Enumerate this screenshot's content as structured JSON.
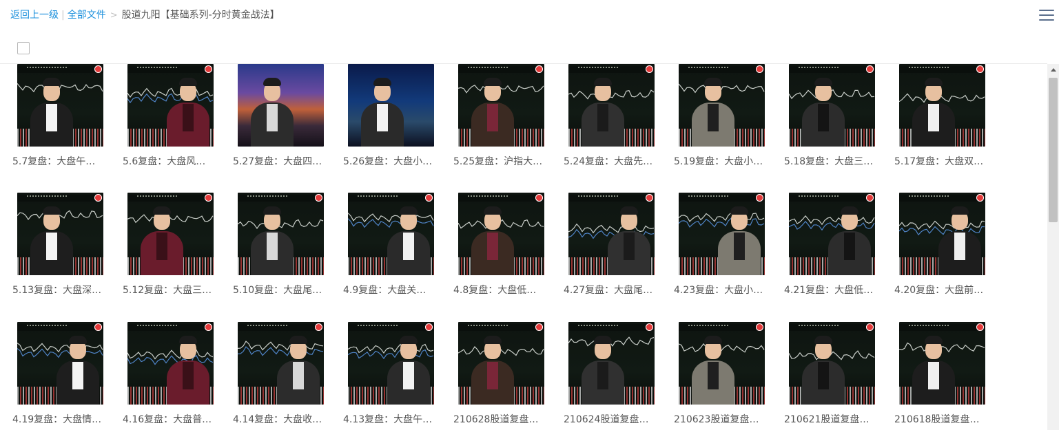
{
  "breadcrumb": {
    "back": "返回上一级",
    "separator": "|",
    "all_files": "全部文件",
    "arrow": ">",
    "current": "股道九阳【基础系列-分时黄金战法】"
  },
  "icons": {
    "menu": "hamburger-menu-icon",
    "select_all": "checkbox"
  },
  "colors": {
    "link": "#1a8fdc",
    "menu_icon": "#5a6e8c",
    "badge": "#e43a3a"
  },
  "files": [
    {
      "title": "5.7复盘：大盘午…",
      "style": "chart"
    },
    {
      "title": "5.6复盘：大盘风…",
      "style": "chart-side"
    },
    {
      "title": "5.27复盘：大盘四…",
      "style": "city-night"
    },
    {
      "title": "5.26复盘：大盘小…",
      "style": "city-blue"
    },
    {
      "title": "5.25复盘：沪指大…",
      "style": "chart"
    },
    {
      "title": "5.24复盘：大盘先…",
      "style": "chart"
    },
    {
      "title": "5.19复盘：大盘小…",
      "style": "chart"
    },
    {
      "title": "5.18复盘：大盘三…",
      "style": "chart"
    },
    {
      "title": "5.17复盘：大盘双…",
      "style": "chart"
    },
    {
      "title": "5.13复盘：大盘深…",
      "style": "chart"
    },
    {
      "title": "5.12复盘：大盘三…",
      "style": "chart"
    },
    {
      "title": "5.10复盘：大盘尾…",
      "style": "chart"
    },
    {
      "title": "4.9复盘：大盘关…",
      "style": "chart-board"
    },
    {
      "title": "4.8复盘：大盘低…",
      "style": "chart"
    },
    {
      "title": "4.27复盘：大盘尾…",
      "style": "chart-board"
    },
    {
      "title": "4.23复盘：大盘小…",
      "style": "chart-side"
    },
    {
      "title": "4.21复盘：大盘低…",
      "style": "chart-board"
    },
    {
      "title": "4.20复盘：大盘前…",
      "style": "chart-side"
    },
    {
      "title": "4.19复盘：大盘情…",
      "style": "chart-side"
    },
    {
      "title": "4.16复盘：大盘普…",
      "style": "chart-side"
    },
    {
      "title": "4.14复盘：大盘收…",
      "style": "chart-side"
    },
    {
      "title": "4.13复盘：大盘午…",
      "style": "chart-side"
    },
    {
      "title": "210628股道复盘…",
      "style": "chart"
    },
    {
      "title": "210624股道复盘…",
      "style": "chart"
    },
    {
      "title": "210623股道复盘…",
      "style": "chart"
    },
    {
      "title": "210621股道复盘…",
      "style": "chart"
    },
    {
      "title": "210618股道复盘…",
      "style": "chart"
    }
  ]
}
